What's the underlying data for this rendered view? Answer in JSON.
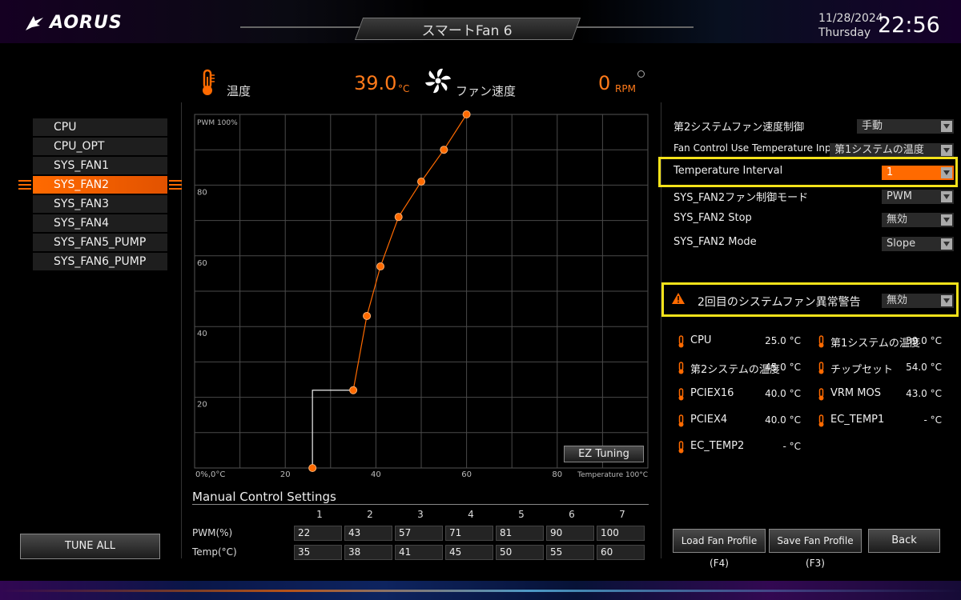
{
  "header": {
    "brand": "AORUS",
    "title": "スマートFan 6",
    "date": "11/28/2024",
    "weekday": "Thursday",
    "time": "22:56"
  },
  "readouts": {
    "temp_label": "温度",
    "temp_value": "39.0",
    "temp_unit": "°C",
    "fan_label": "ファン速度",
    "fan_value": "0",
    "fan_unit": "RPM"
  },
  "fan_list": {
    "items": [
      "CPU",
      "CPU_OPT",
      "SYS_FAN1",
      "SYS_FAN2",
      "SYS_FAN3",
      "SYS_FAN4",
      "SYS_FAN5_PUMP",
      "SYS_FAN6_PUMP"
    ],
    "selected": "SYS_FAN2"
  },
  "tune_all_label": "TUNE ALL",
  "chart_data": {
    "type": "line",
    "x": [
      26,
      35,
      38,
      41,
      45,
      50,
      55,
      60
    ],
    "y": [
      0,
      22,
      43,
      57,
      71,
      81,
      90,
      100
    ],
    "xlim": [
      0,
      100
    ],
    "ylim": [
      0,
      100
    ],
    "x_ticks": [
      "0%,0°C",
      "20",
      "40",
      "60",
      "80"
    ],
    "y_ticks": [
      "20",
      "40",
      "60",
      "80"
    ],
    "y_top_label": "PWM 100%",
    "x_end_label": "Temperature 100°C",
    "grid": true,
    "line_color": "#ff6a00"
  },
  "ez_tuning_label": "EZ Tuning",
  "manual": {
    "title": "Manual Control Settings",
    "columns": [
      "1",
      "2",
      "3",
      "4",
      "5",
      "6",
      "7"
    ],
    "pwm_label": "PWM(%)",
    "temp_label": "Temp(°C)",
    "pwm": [
      "22",
      "43",
      "57",
      "71",
      "81",
      "90",
      "100"
    ],
    "temp": [
      "35",
      "38",
      "41",
      "45",
      "50",
      "55",
      "60"
    ]
  },
  "settings": [
    {
      "label": "第2システムファン速度制御",
      "value": "手動"
    },
    {
      "label": "Fan Control Use Temperature Input",
      "value": "第1システムの温度"
    },
    {
      "label": "Temperature Interval",
      "value": "1"
    },
    {
      "label": "SYS_FAN2ファン制御モード",
      "value": "PWM"
    },
    {
      "label": "SYS_FAN2 Stop",
      "value": "無効"
    },
    {
      "label": "SYS_FAN2 Mode",
      "value": "Slope"
    }
  ],
  "warning": {
    "label": "2回目のシステムファン異常警告",
    "value": "無効"
  },
  "temperatures": [
    {
      "name": "CPU",
      "value": "25.0 °C"
    },
    {
      "name": "第1システムの温度",
      "value": "39.0 °C"
    },
    {
      "name": "第2システムの温度",
      "value": "45.0 °C"
    },
    {
      "name": "チップセット",
      "value": "54.0 °C"
    },
    {
      "name": "PCIEX16",
      "value": "40.0 °C"
    },
    {
      "name": "VRM MOS",
      "value": "43.0 °C"
    },
    {
      "name": "PCIEX4",
      "value": "40.0 °C"
    },
    {
      "name": "EC_TEMP1",
      "value": "- °C"
    },
    {
      "name": "EC_TEMP2",
      "value": "- °C"
    }
  ],
  "buttons": {
    "load": "Load Fan Profile (F4)",
    "save": "Save Fan Profile (F3)",
    "back": "Back"
  },
  "colors": {
    "accent": "#ff6a00",
    "highlight": "#f4e21a"
  }
}
